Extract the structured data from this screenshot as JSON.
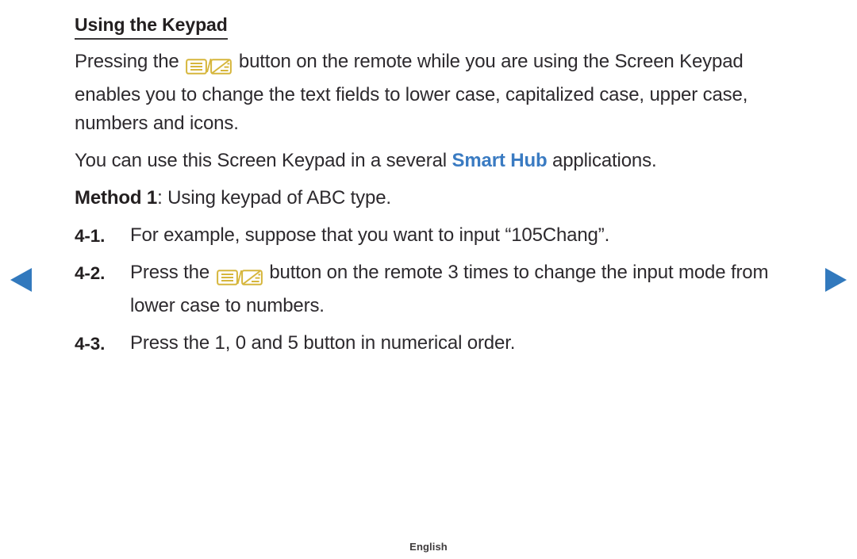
{
  "page": {
    "title": "Using the Keypad",
    "footer_label": "English",
    "colors": {
      "text": "#2d2a2e",
      "heading": "#231f20",
      "accent_blue": "#3a7bc2",
      "icon_gold": "#d6b63c",
      "arrow_blue": "#3279bd",
      "background": "#ffffff"
    }
  },
  "paragraphs": {
    "p1_a": "Pressing the ",
    "p1_icon": "mode-change-key-icon",
    "p1_b": " button on the remote while you are using the Screen Keypad enables you to change the text fields to lower case, capitalized case, upper case, numbers and icons.",
    "p2_a": "You can use this Screen Keypad in a several ",
    "p2_highlight": "Smart Hub",
    "p2_b": " applications.",
    "p3_bold": "Method 1",
    "p3_rest": ": Using keypad of ABC type."
  },
  "steps": [
    {
      "number": "4-1.",
      "text_a": "For example, suppose that you want to input “105Chang”.",
      "icon": null,
      "text_b": ""
    },
    {
      "number": "4-2.",
      "text_a": "Press the ",
      "icon": "mode-change-key-icon",
      "text_b": " button on the remote 3 times to change the input mode from lower case to numbers."
    },
    {
      "number": "4-3.",
      "text_a": "Press the 1, 0 and 5 button in numerical order.",
      "icon": null,
      "text_b": ""
    }
  ],
  "navigation": {
    "prev_label": "previous-page-arrow",
    "next_label": "next-page-arrow"
  }
}
